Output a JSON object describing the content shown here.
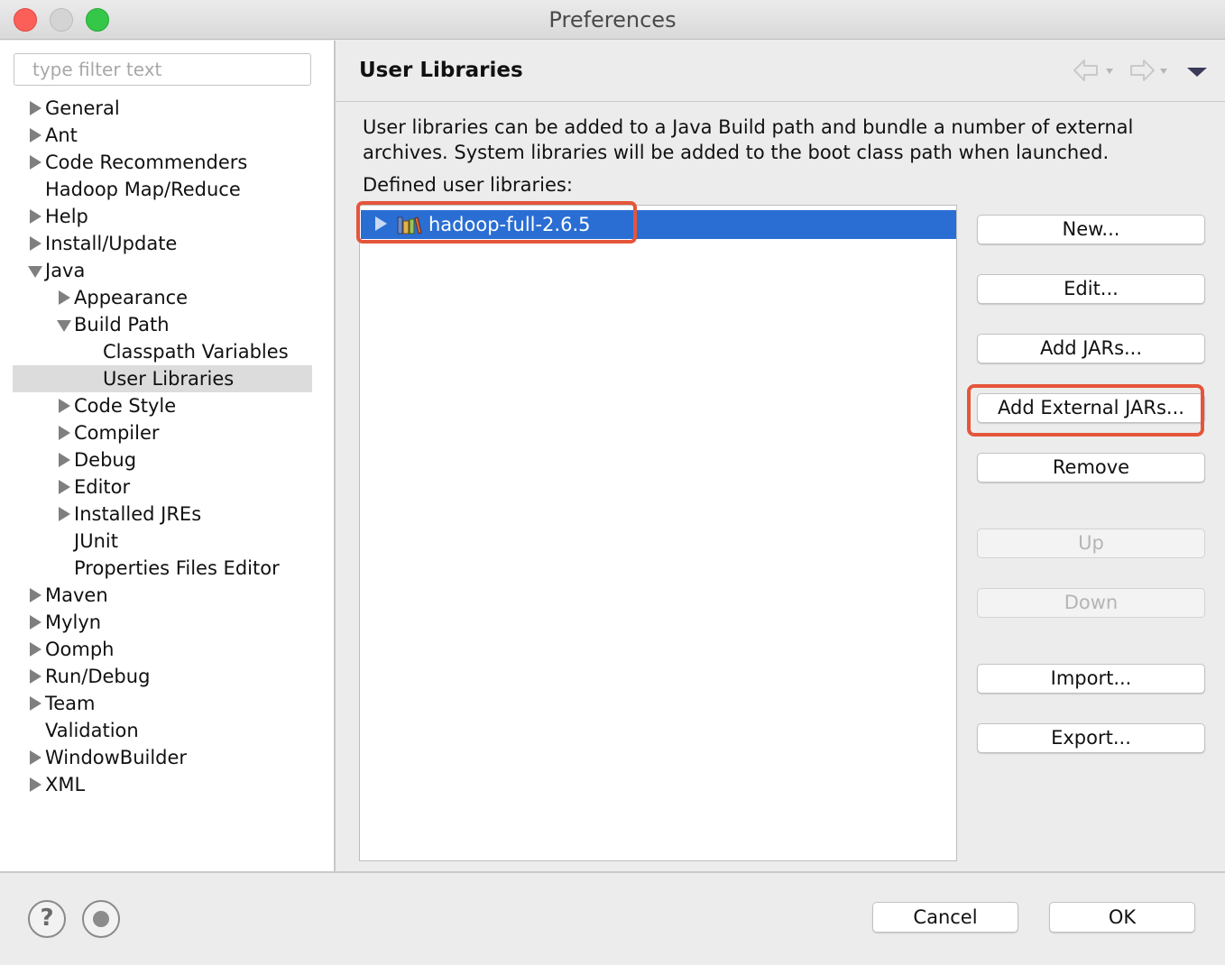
{
  "window": {
    "title": "Preferences"
  },
  "sidebar": {
    "filter_placeholder": "type filter text",
    "items": [
      {
        "label": "General",
        "level": 0,
        "expander": "collapsed"
      },
      {
        "label": "Ant",
        "level": 0,
        "expander": "collapsed"
      },
      {
        "label": "Code Recommenders",
        "level": 0,
        "expander": "collapsed"
      },
      {
        "label": "Hadoop Map/Reduce",
        "level": 0,
        "expander": "none"
      },
      {
        "label": "Help",
        "level": 0,
        "expander": "collapsed"
      },
      {
        "label": "Install/Update",
        "level": 0,
        "expander": "collapsed"
      },
      {
        "label": "Java",
        "level": 0,
        "expander": "expanded"
      },
      {
        "label": "Appearance",
        "level": 1,
        "expander": "collapsed"
      },
      {
        "label": "Build Path",
        "level": 1,
        "expander": "expanded"
      },
      {
        "label": "Classpath Variables",
        "level": 2,
        "expander": "none"
      },
      {
        "label": "User Libraries",
        "level": 2,
        "expander": "none",
        "selected": true
      },
      {
        "label": "Code Style",
        "level": 1,
        "expander": "collapsed"
      },
      {
        "label": "Compiler",
        "level": 1,
        "expander": "collapsed"
      },
      {
        "label": "Debug",
        "level": 1,
        "expander": "collapsed"
      },
      {
        "label": "Editor",
        "level": 1,
        "expander": "collapsed"
      },
      {
        "label": "Installed JREs",
        "level": 1,
        "expander": "collapsed"
      },
      {
        "label": "JUnit",
        "level": 1,
        "expander": "none"
      },
      {
        "label": "Properties Files Editor",
        "level": 1,
        "expander": "none"
      },
      {
        "label": "Maven",
        "level": 0,
        "expander": "collapsed"
      },
      {
        "label": "Mylyn",
        "level": 0,
        "expander": "collapsed"
      },
      {
        "label": "Oomph",
        "level": 0,
        "expander": "collapsed"
      },
      {
        "label": "Run/Debug",
        "level": 0,
        "expander": "collapsed"
      },
      {
        "label": "Team",
        "level": 0,
        "expander": "collapsed"
      },
      {
        "label": "Validation",
        "level": 0,
        "expander": "none"
      },
      {
        "label": "WindowBuilder",
        "level": 0,
        "expander": "collapsed"
      },
      {
        "label": "XML",
        "level": 0,
        "expander": "collapsed"
      }
    ]
  },
  "page": {
    "title": "User Libraries",
    "description_line1": "User libraries can be added to a Java Build path and bundle a number of external",
    "description_line2": "archives. System libraries will be added to the boot class path when launched.",
    "list_label": "Defined user libraries:",
    "libraries": [
      {
        "name": "hadoop-full-2.6.5",
        "selected": true,
        "icon": "library-icon"
      }
    ],
    "buttons": {
      "new": "New...",
      "edit": "Edit...",
      "add_jars": "Add JARs...",
      "add_external_jars": "Add External JARs...",
      "remove": "Remove",
      "up": "Up",
      "down": "Down",
      "import": "Import...",
      "export": "Export..."
    },
    "disabled_buttons": [
      "up",
      "down"
    ]
  },
  "footer": {
    "help_glyph": "?",
    "cancel": "Cancel",
    "ok": "OK"
  },
  "colors": {
    "selection": "#2a6ed4",
    "annotation": "#e5553a",
    "tree_selection": "#dcdcdc"
  }
}
